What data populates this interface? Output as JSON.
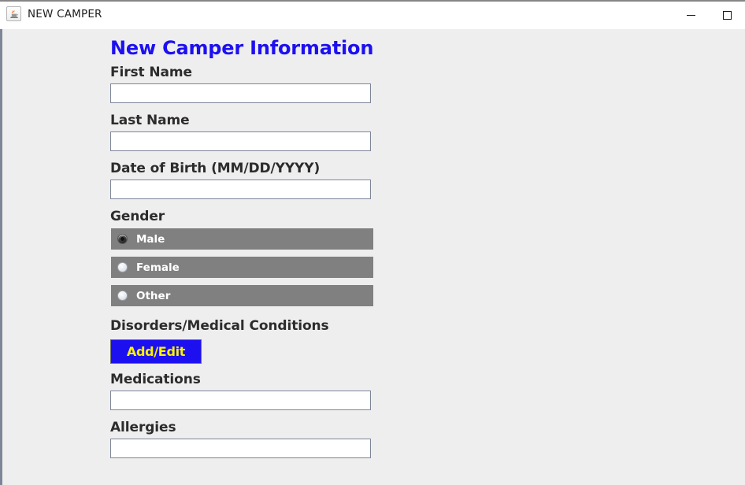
{
  "window": {
    "title": "NEW CAMPER",
    "app_icon": "java-coffee-cup-icon",
    "buttons": {
      "minimize": "minimize-icon",
      "maximize": "maximize-icon"
    }
  },
  "form": {
    "heading": "New Camper Information",
    "fields": [
      {
        "label": "First Name",
        "value": "",
        "placeholder": ""
      },
      {
        "label": "Last Name",
        "value": "",
        "placeholder": ""
      },
      {
        "label": "Date of Birth (MM/DD/YYYY)",
        "value": "",
        "placeholder": ""
      }
    ],
    "gender": {
      "label": "Gender",
      "options": [
        {
          "label": "Male",
          "selected": true
        },
        {
          "label": "Female",
          "selected": false
        },
        {
          "label": "Other",
          "selected": false
        }
      ]
    },
    "disorders": {
      "label": "Disorders/Medical Conditions",
      "button_label": "Add/Edit"
    },
    "medications": {
      "label": "Medications",
      "value": "",
      "placeholder": ""
    },
    "allergies": {
      "label": "Allergies",
      "value": "",
      "placeholder": ""
    }
  },
  "colors": {
    "heading_blue": "#1d10f0",
    "button_blue": "#1d10f0",
    "button_text_yellow": "#fbf300",
    "radio_row_gray": "#808080",
    "background": "#eeeeee",
    "field_border": "#7d8698",
    "label_text": "#2c2c2c"
  }
}
